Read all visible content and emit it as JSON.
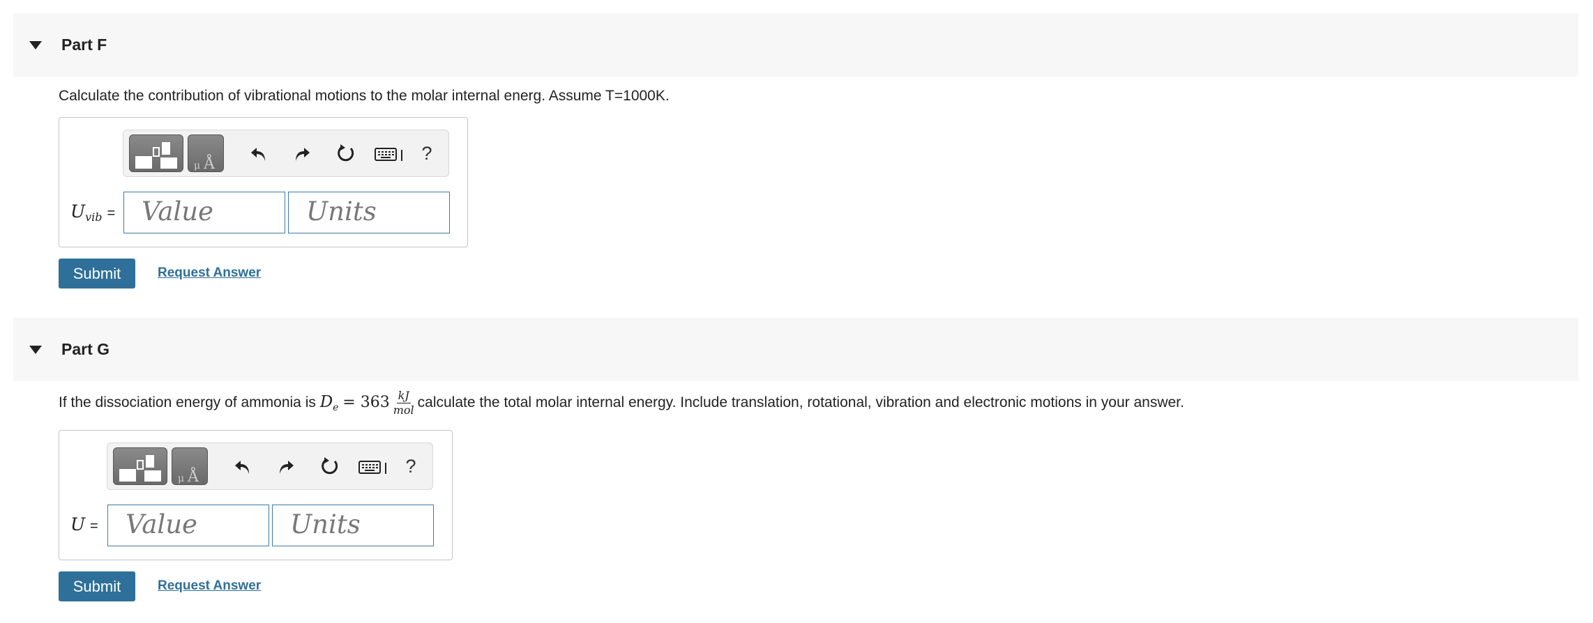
{
  "part_f": {
    "title": "Part F",
    "question": "Calculate the contribution of vibrational motions to the molar internal energ. Assume T=1000K.",
    "answer_var": "U",
    "answer_sub": "vib",
    "equals": "=",
    "value_placeholder": "Value",
    "units_placeholder": "Units",
    "submit_label": "Submit",
    "request_label": "Request Answer",
    "toolbar_help": "?"
  },
  "part_g": {
    "title": "Part G",
    "question_prefix": "If the dissociation energy of ammonia is",
    "math_var": "D",
    "math_sub": "e",
    "math_eq": "= 363",
    "frac_num": "kJ",
    "frac_den": "mol",
    "question_suffix": "calculate the total molar internal energy. Include translation, rotational, vibration and electronic motions in your answer.",
    "answer_var": "U",
    "equals": "=",
    "value_placeholder": "Value",
    "units_placeholder": "Units",
    "submit_label": "Submit",
    "request_label": "Request Answer",
    "toolbar_help": "?"
  },
  "icons": [
    "caret-down-icon",
    "templates-icon",
    "symbols-icon",
    "undo-icon",
    "redo-icon",
    "reset-icon",
    "keyboard-icon",
    "help-icon"
  ]
}
